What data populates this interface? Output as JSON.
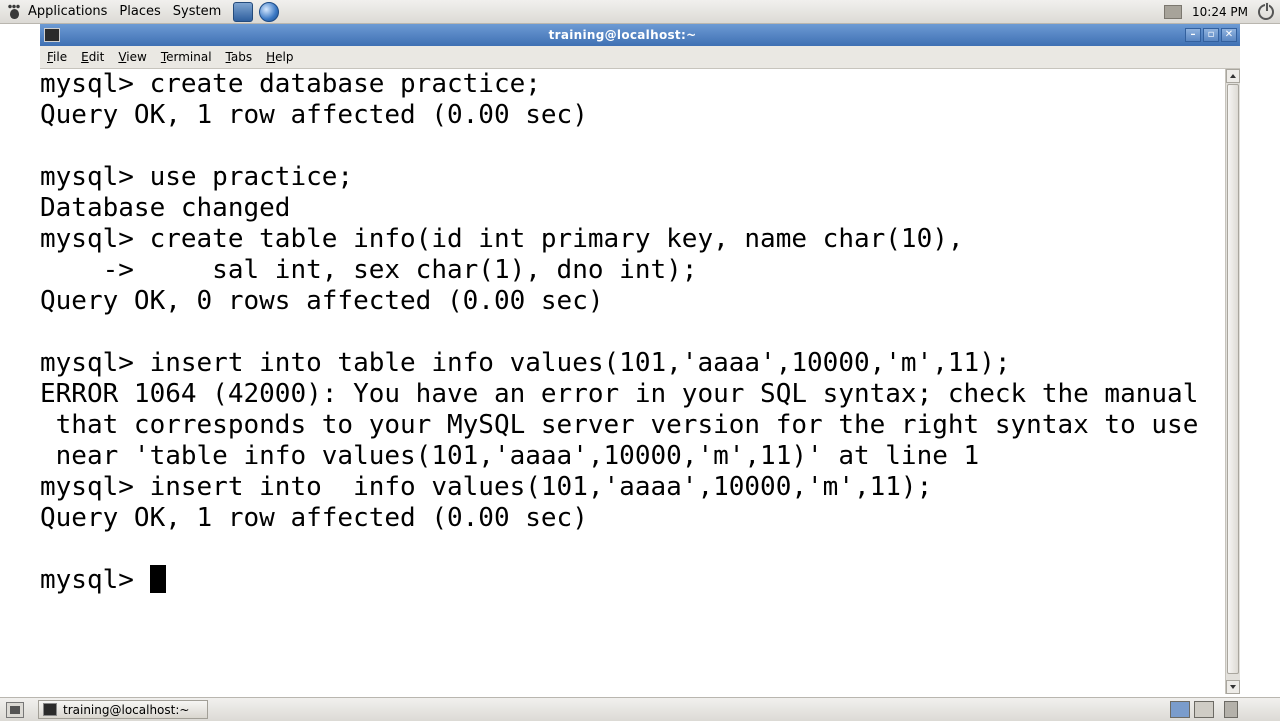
{
  "top_panel": {
    "menus": [
      "Applications",
      "Places",
      "System"
    ],
    "clock": "10:24 PM"
  },
  "window": {
    "title": "training@localhost:~"
  },
  "menubar": {
    "items": [
      "File",
      "Edit",
      "View",
      "Terminal",
      "Tabs",
      "Help"
    ]
  },
  "terminal": {
    "lines": [
      "mysql> create database practice;",
      "Query OK, 1 row affected (0.00 sec)",
      "",
      "mysql> use practice;",
      "Database changed",
      "mysql> create table info(id int primary key, name char(10),",
      "    ->     sal int, sex char(1), dno int);",
      "Query OK, 0 rows affected (0.00 sec)",
      "",
      "mysql> insert into table info values(101,'aaaa',10000,'m',11);",
      "ERROR 1064 (42000): You have an error in your SQL syntax; check the manual",
      " that corresponds to your MySQL server version for the right syntax to use",
      " near 'table info values(101,'aaaa',10000,'m',11)' at line 1",
      "mysql> insert into  info values(101,'aaaa',10000,'m',11);",
      "Query OK, 1 row affected (0.00 sec)",
      ""
    ],
    "prompt": "mysql> "
  },
  "taskbar": {
    "task_label": "training@localhost:~"
  }
}
